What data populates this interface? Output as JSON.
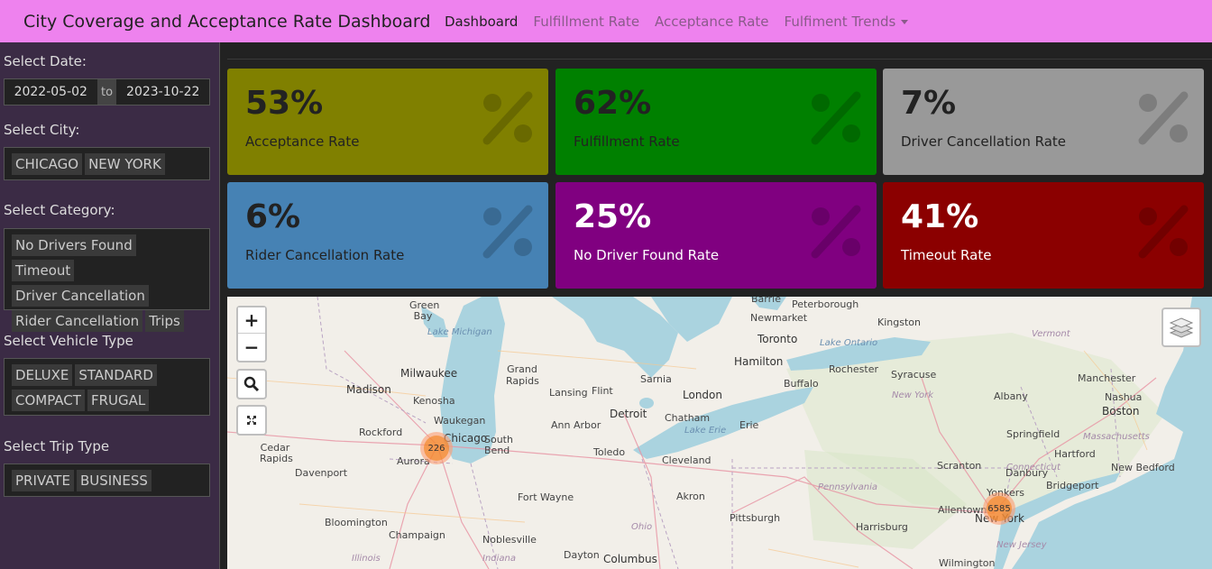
{
  "navbar": {
    "brand": "City Coverage and Acceptance Rate Dashboard",
    "links": [
      "Dashboard",
      "Fulfillment Rate",
      "Acceptance Rate",
      "Fulfiment Trends"
    ],
    "bg_color": "#ee82ee"
  },
  "sidebar": {
    "date_label": "Select Date:",
    "date_start": "2022-05-02",
    "date_to": "to",
    "date_end": "2023-10-22",
    "city_label": "Select City:",
    "cities": [
      "CHICAGO",
      "NEW YORK"
    ],
    "category_label": "Select Category:",
    "categories": [
      "No Drivers Found",
      "Timeout",
      "Driver Cancellation",
      "Rider Cancellation",
      "Trips"
    ],
    "vehicle_label": "Select Vehicle Type",
    "vehicles": [
      "DELUXE",
      "STANDARD",
      "COMPACT",
      "FRUGAL"
    ],
    "trip_label": "Select Trip Type",
    "trip_types": [
      "PRIVATE",
      "BUSINESS"
    ]
  },
  "cards": [
    {
      "value": "53%",
      "label": "Acceptance Rate",
      "bg": "#808000",
      "text": "#222"
    },
    {
      "value": "62%",
      "label": "Fulfillment Rate",
      "bg": "#008000",
      "text": "#222"
    },
    {
      "value": "7%",
      "label": "Driver Cancellation Rate",
      "bg": "#999999",
      "text": "#222"
    },
    {
      "value": "6%",
      "label": "Rider Cancellation Rate",
      "bg": "#4682b4",
      "text": "#222"
    },
    {
      "value": "25%",
      "label": "No Driver Found Rate",
      "bg": "#800080",
      "text": "#ffffff"
    },
    {
      "value": "41%",
      "label": "Timeout Rate",
      "bg": "#8b0000",
      "text": "#ffffff"
    }
  ],
  "map": {
    "zoom_in": "+",
    "zoom_out": "−",
    "icons": [
      "search-icon",
      "fullscreen-icon",
      "layers-icon"
    ],
    "water_labels": [
      "Lake Michigan",
      "Lake Ontario",
      "Lake Erie"
    ],
    "region_labels": [
      "Vermont",
      "New York",
      "Massachusetts",
      "Connecticut",
      "Pennsylvania",
      "Ohio",
      "Illinois",
      "Indiana",
      "New Jersey"
    ],
    "cities": [
      "Barrie",
      "Peterborough",
      "Green Bay",
      "Newmarket",
      "Kingston",
      "Toronto",
      "Hamilton",
      "Rochester",
      "Syracuse",
      "Manchester",
      "Milwaukee",
      "Grand Rapids",
      "Sarnia",
      "Madison",
      "Lansing",
      "Flint",
      "London",
      "Buffalo",
      "Albany",
      "Nashua",
      "Kenosha",
      "Boston",
      "Waukegan",
      "Detroit",
      "Chatham",
      "Erie",
      "Rockford",
      "Ann Arbor",
      "Springfield",
      "Chicago",
      "South Bend",
      "Cedar Rapids",
      "Aurora",
      "Toledo",
      "Cleveland",
      "Hartford",
      "New Bedford",
      "Davenport",
      "Scranton",
      "Danbury",
      "Bridgeport",
      "Fort Wayne",
      "Akron",
      "Yonkers",
      "Allentown",
      "New York",
      "Bloomington",
      "Pittsburgh",
      "Harrisburg",
      "Champaign",
      "Noblesville",
      "Dayton",
      "Columbus",
      "Wilmington"
    ],
    "clusters": [
      {
        "label": "226",
        "city": "Chicago"
      },
      {
        "label": "6585",
        "city": "New York"
      }
    ]
  }
}
